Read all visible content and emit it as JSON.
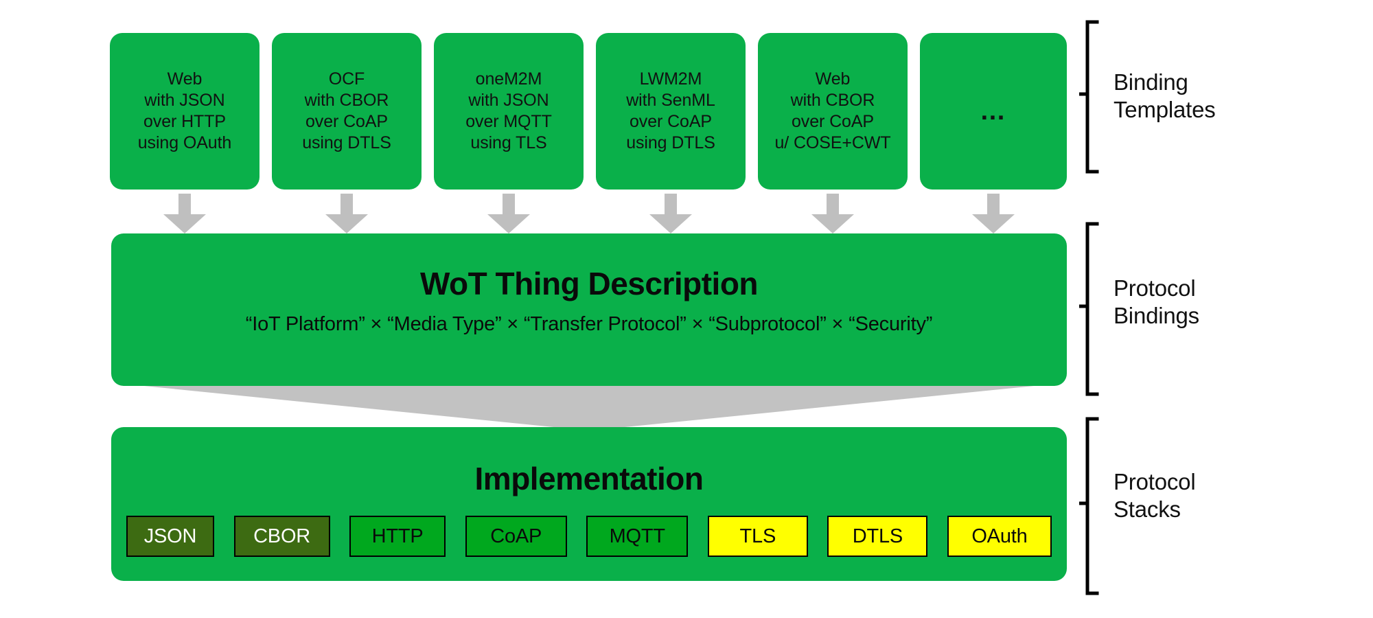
{
  "colors": {
    "panel_green": "#0ab04a",
    "arrow_gray": "#bfbfbf",
    "badge_dark_green": "#3d6b12",
    "badge_bright_green": "#00a81e",
    "badge_yellow": "#ffff00",
    "text_dark": "#111111",
    "brace_black": "#000000",
    "background": "#ffffff"
  },
  "binding_templates": {
    "cards": [
      {
        "id": "web-json-http-oauth",
        "text": "Web\nwith JSON\nover HTTP\nusing OAuth",
        "is_ellipsis": false
      },
      {
        "id": "ocf-cbor-coap-dtls",
        "text": "OCF\nwith CBOR\nover CoAP\nusing DTLS",
        "is_ellipsis": false
      },
      {
        "id": "onem2m-json-mqtt-tls",
        "text": "oneM2M\nwith JSON\nover MQTT\nusing TLS",
        "is_ellipsis": false
      },
      {
        "id": "lwm2m-senml-coap-dtls",
        "text": "LWM2M\nwith SenML\nover CoAP\nusing DTLS",
        "is_ellipsis": false
      },
      {
        "id": "web-cbor-coap-cose-cwt",
        "text": "Web\nwith CBOR\nover CoAP\nu/ COSE+CWT",
        "is_ellipsis": false
      },
      {
        "id": "more",
        "text": "…",
        "is_ellipsis": true
      }
    ]
  },
  "thing_description": {
    "title": "WoT Thing Description",
    "subtitle": "“IoT Platform” × “Media Type” × “Transfer Protocol” × “Subprotocol” × “Security”"
  },
  "implementation": {
    "title": "Implementation",
    "badges": [
      {
        "label": "JSON",
        "style": "dark-green"
      },
      {
        "label": "CBOR",
        "style": "dark-green"
      },
      {
        "label": "HTTP",
        "style": "bright-green"
      },
      {
        "label": "CoAP",
        "style": "bright-green"
      },
      {
        "label": "MQTT",
        "style": "bright-green"
      },
      {
        "label": "TLS",
        "style": "yellow"
      },
      {
        "label": "DTLS",
        "style": "yellow"
      },
      {
        "label": "OAuth",
        "style": "yellow"
      }
    ]
  },
  "group_labels": {
    "binding_templates": "Binding\nTemplates",
    "protocol_bindings": "Protocol\nBindings",
    "protocol_stacks": "Protocol\nStacks"
  },
  "icons": {
    "down_arrow": "down-arrow-icon",
    "funnel_triangle": "funnel-triangle-icon",
    "curly_brace": "curly-brace-icon"
  }
}
